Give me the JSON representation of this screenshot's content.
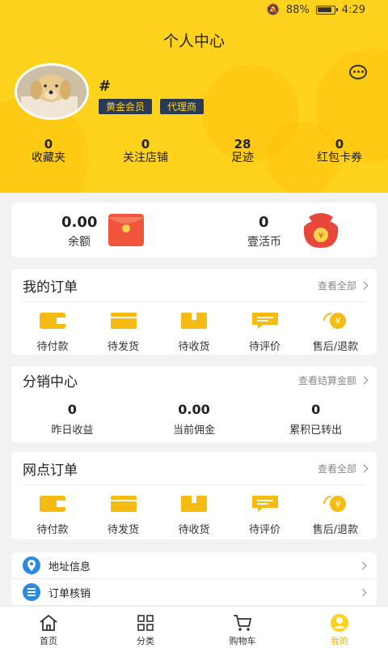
{
  "status_bar": {
    "battery": "88%",
    "time": "4:29"
  },
  "header": {
    "title": "个人中心",
    "username": "#",
    "tags": [
      "黄金会员",
      "代理商"
    ],
    "stats": [
      {
        "value": "0",
        "label": "收藏夹"
      },
      {
        "value": "0",
        "label": "关注店铺"
      },
      {
        "value": "28",
        "label": "足迹"
      },
      {
        "value": "0",
        "label": "红包卡券"
      }
    ]
  },
  "wallet": {
    "balance": {
      "value": "0.00",
      "label": "余额"
    },
    "coins": {
      "value": "0",
      "label": "壹活币"
    }
  },
  "my_orders": {
    "title": "我的订单",
    "more": "查看全部",
    "items": [
      "待付款",
      "待发货",
      "待收货",
      "待评价",
      "售后/退款"
    ]
  },
  "distribution": {
    "title": "分销中心",
    "more": "查看结算金额",
    "items": [
      {
        "value": "0",
        "label": "昨日收益"
      },
      {
        "value": "0.00",
        "label": "当前佣金"
      },
      {
        "value": "0",
        "label": "累积已转出"
      }
    ]
  },
  "outlet_orders": {
    "title": "网点订单",
    "more": "查看全部",
    "items": [
      "待付款",
      "待发货",
      "待收货",
      "待评价",
      "售后/退款"
    ]
  },
  "menu": [
    {
      "label": "地址信息",
      "icon": "location-icon"
    },
    {
      "label": "订单核销",
      "icon": "list-icon"
    }
  ],
  "tabbar": [
    {
      "label": "首页",
      "icon": "home-icon"
    },
    {
      "label": "分类",
      "icon": "grid-icon"
    },
    {
      "label": "购物车",
      "icon": "cart-icon"
    },
    {
      "label": "我的",
      "icon": "user-icon"
    }
  ],
  "colors": {
    "brand_yellow": "#ffd21e",
    "icon_yellow": "#f5bb12",
    "tag_bg": "#2a3a52"
  }
}
